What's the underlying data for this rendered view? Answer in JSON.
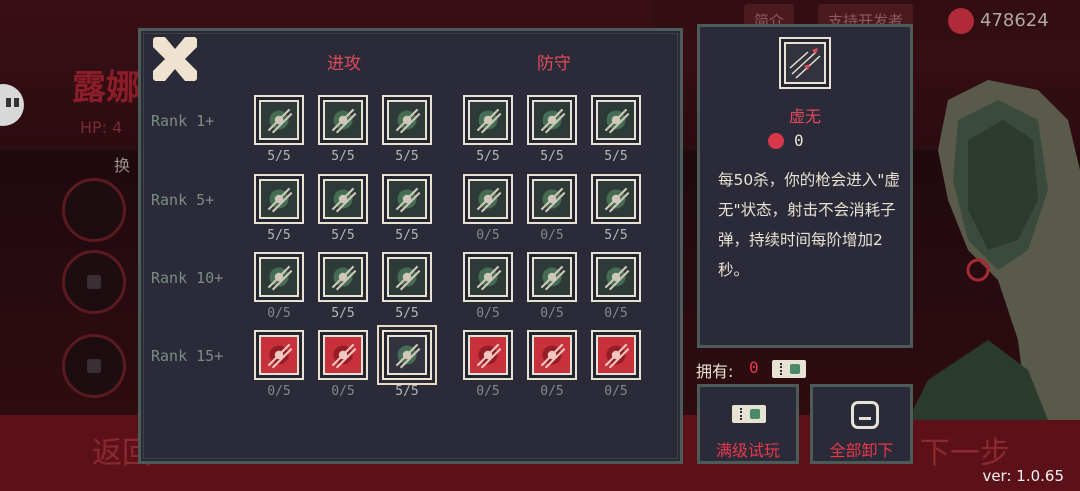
{
  "background": {
    "character_name": "露娜",
    "hp_label": "HP: 4",
    "swap_label": "换",
    "back_label": "返回",
    "next_label": "下一步",
    "top_buttons": [
      "简介",
      "支持开发者"
    ],
    "coins": "478624"
  },
  "panel": {
    "offense_header": "进攻",
    "defense_header": "防守",
    "ranks": [
      {
        "label": "Rank 1+",
        "offense": [
          {
            "icon": "diagonal-slashes-icon",
            "count": "5/5"
          },
          {
            "icon": "vortex-icon",
            "count": "5/5"
          },
          {
            "icon": "fist-icon",
            "count": "5/5"
          }
        ],
        "defense": [
          {
            "icon": "triangle-shield-icon",
            "count": "5/5"
          },
          {
            "icon": "flex-arm-icon",
            "count": "5/5"
          },
          {
            "icon": "clock-shield-icon",
            "count": "5/5"
          }
        ]
      },
      {
        "label": "Rank 5+",
        "offense": [
          {
            "icon": "spread-shot-icon",
            "count": "5/5"
          },
          {
            "icon": "claw-marks-icon",
            "count": "5/5"
          },
          {
            "icon": "curved-blades-icon",
            "count": "5/5"
          }
        ],
        "defense": [
          {
            "icon": "dash-runner-icon",
            "count": "0/5"
          },
          {
            "icon": "leg-kick-icon",
            "count": "0/5"
          },
          {
            "icon": "leaf-shield-icon",
            "count": "5/5"
          }
        ]
      },
      {
        "label": "Rank 10+",
        "offense": [
          {
            "icon": "bomb-spark-icon",
            "count": "0/5"
          },
          {
            "icon": "muscle-figure-icon",
            "count": "5/5"
          },
          {
            "icon": "starburst-icon",
            "count": "5/5"
          }
        ],
        "defense": [
          {
            "icon": "medallion-icon",
            "count": "0/5"
          },
          {
            "icon": "hearts-icon",
            "count": "0/5"
          },
          {
            "icon": "statue-figure-icon",
            "count": "0/5"
          }
        ]
      },
      {
        "label": "Rank 15+",
        "offense": [
          {
            "icon": "fireball-icon",
            "count": "0/5"
          },
          {
            "icon": "red-beast-icon",
            "count": "0/5"
          },
          {
            "icon": "void-bullets-icon",
            "count": "5/5"
          }
        ],
        "defense": [
          {
            "icon": "holy-heart-icon",
            "count": "0/5"
          },
          {
            "icon": "winged-angel-icon",
            "count": "0/5"
          },
          {
            "icon": "red-swirl-icon",
            "count": "0/5"
          }
        ]
      }
    ]
  },
  "info": {
    "title": "虚无",
    "cost": "0",
    "description": "每50杀，你的枪会进入\"虚无\"状态，射击不会消耗子弹，持续时间每阶增加2秒。"
  },
  "owned": {
    "label": "拥有:",
    "value": "0"
  },
  "buttons": {
    "trial_label": "满级试玩",
    "unequip_label": "全部卸下"
  },
  "version": "ver: 1.0.65",
  "colors": {
    "accent_red": "#e44a5a",
    "panel_bg": "#2a2a38",
    "panel_border": "#4c5a58",
    "icon_cream": "#e8e2d2"
  }
}
